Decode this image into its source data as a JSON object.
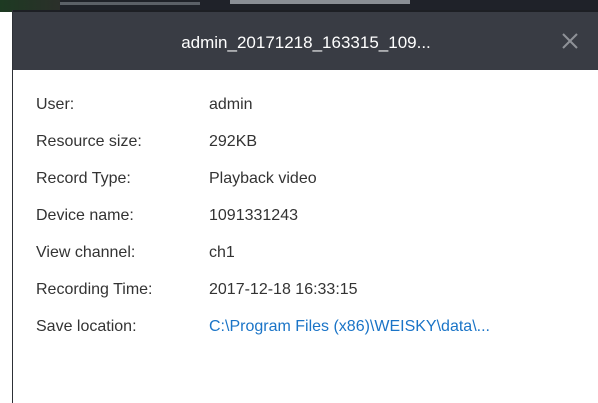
{
  "dialog": {
    "title": "admin_20171218_163315_109...",
    "close_icon": "close-icon",
    "fields": [
      {
        "label": "User:",
        "value": "admin"
      },
      {
        "label": "Resource size:",
        "value": "292KB"
      },
      {
        "label": "Record Type:",
        "value": "Playback video"
      },
      {
        "label": "Device name:",
        "value": "1091331243"
      },
      {
        "label": "View channel:",
        "value": "ch1"
      },
      {
        "label": "Recording Time:",
        "value": "2017-12-18 16:33:15"
      },
      {
        "label": "Save location:",
        "value": "C:\\Program Files (x86)\\WEISKY\\data\\..."
      }
    ]
  },
  "colors": {
    "titlebar_bg": "#393c44",
    "title_text": "#ffffff",
    "label_text": "#333333",
    "link_text": "#1a74c7"
  }
}
